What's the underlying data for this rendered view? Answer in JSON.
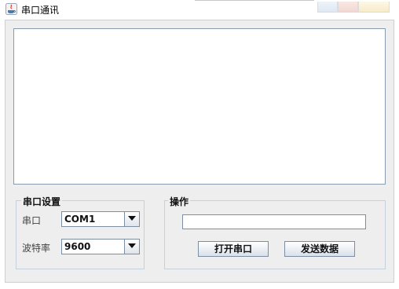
{
  "window": {
    "title": "串口通讯",
    "icon": "java-cup-icon",
    "colors": {
      "minimize": "#e6edf7",
      "maximize": "#f5ddd8",
      "close": "#faf0d0"
    }
  },
  "output_area": {
    "content": ""
  },
  "serial_settings": {
    "legend": "串口设置",
    "port_label": "串口",
    "port_value": "COM1",
    "baud_label": "波特率",
    "baud_value": "9600"
  },
  "operations": {
    "legend": "操作",
    "send_text": "",
    "open_button": "打开串口",
    "send_button": "发送数据"
  }
}
